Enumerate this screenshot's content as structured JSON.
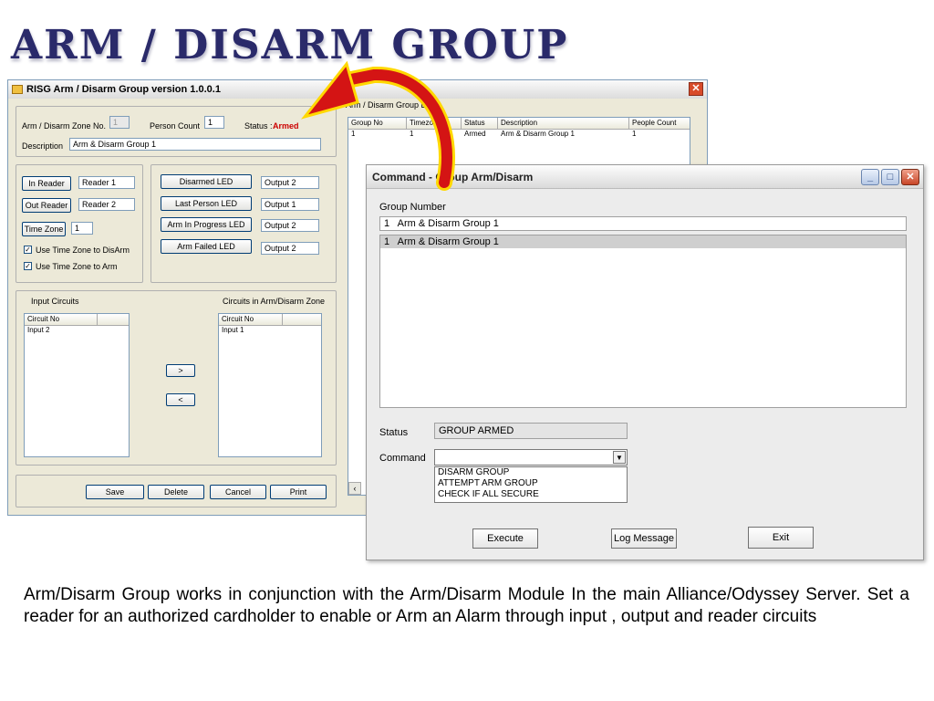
{
  "slide": {
    "title": "ARM / DISARM GROUP",
    "description": "Arm/Disarm Group works in conjunction with the Arm/Disarm Module In the main Alliance/Odyssey Server. Set a reader for an authorized cardholder to enable or Arm an Alarm through input , output and reader circuits"
  },
  "main_window": {
    "title": "RISG Arm / Disarm Group version 1.0.0.1",
    "zone_no_label": "Arm / Disarm Zone No.",
    "zone_no_value": "1",
    "person_count_label": "Person Count",
    "person_count_value": "1",
    "status_label": "Status :",
    "status_value": "Armed",
    "description_label": "Description",
    "description_value": "Arm & Disarm Group 1",
    "in_reader_button": "In Reader",
    "in_reader_value": "Reader 1",
    "out_reader_button": "Out Reader",
    "out_reader_value": "Reader 2",
    "time_zone_button": "Time Zone",
    "time_zone_value": "1",
    "use_tz_disarm": "Use Time Zone to DisArm",
    "use_tz_arm": "Use Time Zone to Arm",
    "disarmed_led_button": "Disarmed LED",
    "disarmed_led_value": "Output 2",
    "last_person_led_button": "Last Person LED",
    "last_person_led_value": "Output 1",
    "arm_progress_led_button": "Arm In Progress LED",
    "arm_progress_led_value": "Output 2",
    "arm_failed_led_button": "Arm Failed LED",
    "arm_failed_led_value": "Output 2",
    "input_circuits_label": "Input Circuits",
    "zone_circuits_label": "Circuits in Arm/Disarm Zone",
    "circuit_no_header": "Circuit No",
    "input_list": [
      "Input 2"
    ],
    "zone_list": [
      "Input 1"
    ],
    "move_right": ">",
    "move_left": "<",
    "save_button": "Save",
    "delete_button": "Delete",
    "cancel_button": "Cancel",
    "print_button": "Print"
  },
  "group_list": {
    "label": "Arm / Disarm Group List",
    "headers": [
      "Group No",
      "Timezone",
      "Status",
      "Description",
      "People Count"
    ],
    "rows": [
      [
        "1",
        "1",
        "Armed",
        "Arm & Disarm Group 1",
        "1"
      ]
    ]
  },
  "command_window": {
    "title": "Command - Group Arm/Disarm",
    "group_number_label": "Group Number",
    "group_number_value": "1   Arm & Disarm Group 1",
    "list_items": [
      "1   Arm & Disarm Group 1"
    ],
    "status_label": "Status",
    "status_value": "GROUP ARMED",
    "command_label": "Command",
    "command_value": "",
    "command_options": [
      "DISARM GROUP",
      "ATTEMPT ARM GROUP",
      "CHECK IF ALL SECURE"
    ],
    "execute_button": "Execute",
    "log_button": "Log Message",
    "exit_button": "Exit"
  },
  "colors": {
    "status_armed": "#cc0000",
    "arrow_red": "#d41414",
    "arrow_yellow": "#ffd800",
    "title_navy": "#2a2a6a"
  }
}
